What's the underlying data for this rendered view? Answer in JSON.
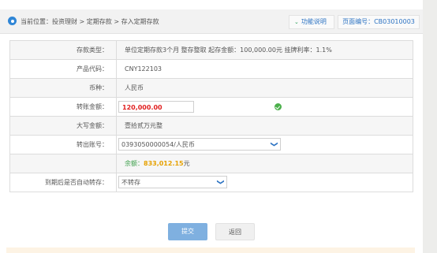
{
  "breadcrumb": {
    "text": "当前位置：投资理财 > 定期存款 > 存入定期存款"
  },
  "header": {
    "function_help": "功能说明",
    "page_no": "页面编号：CB03010003"
  },
  "form": {
    "deposit_type": {
      "label": "存款类型：",
      "value": "单位定期存款3个月  整存整取  起存金额：100,000.00元  挂牌利率：1.1%"
    },
    "product_code": {
      "label": "产品代码：",
      "value": "CNY122103"
    },
    "currency": {
      "label": "币种：",
      "value": "人民币"
    },
    "transfer_amount": {
      "label": "转账金额：",
      "value": "120,000.00"
    },
    "amount_words": {
      "label": "大写金额：",
      "value": "壹拾贰万元整"
    },
    "out_account": {
      "label": "转出账号：",
      "value": "0393050000054/人民币"
    },
    "balance": {
      "label": "余额：",
      "value": "833,012.15",
      "unit": "元"
    },
    "auto_renew": {
      "label": "到期后是否自动转存：",
      "value": "不转存"
    }
  },
  "actions": {
    "submit": "提交",
    "back": "返回"
  },
  "colors": {
    "accent": "#2b72c2",
    "amount_red": "#e02020",
    "balance_orange": "#e6a100",
    "ok_green": "#4bb04b"
  },
  "icons": [
    "location-icon",
    "chevron-down-icon",
    "check-circle-icon"
  ]
}
